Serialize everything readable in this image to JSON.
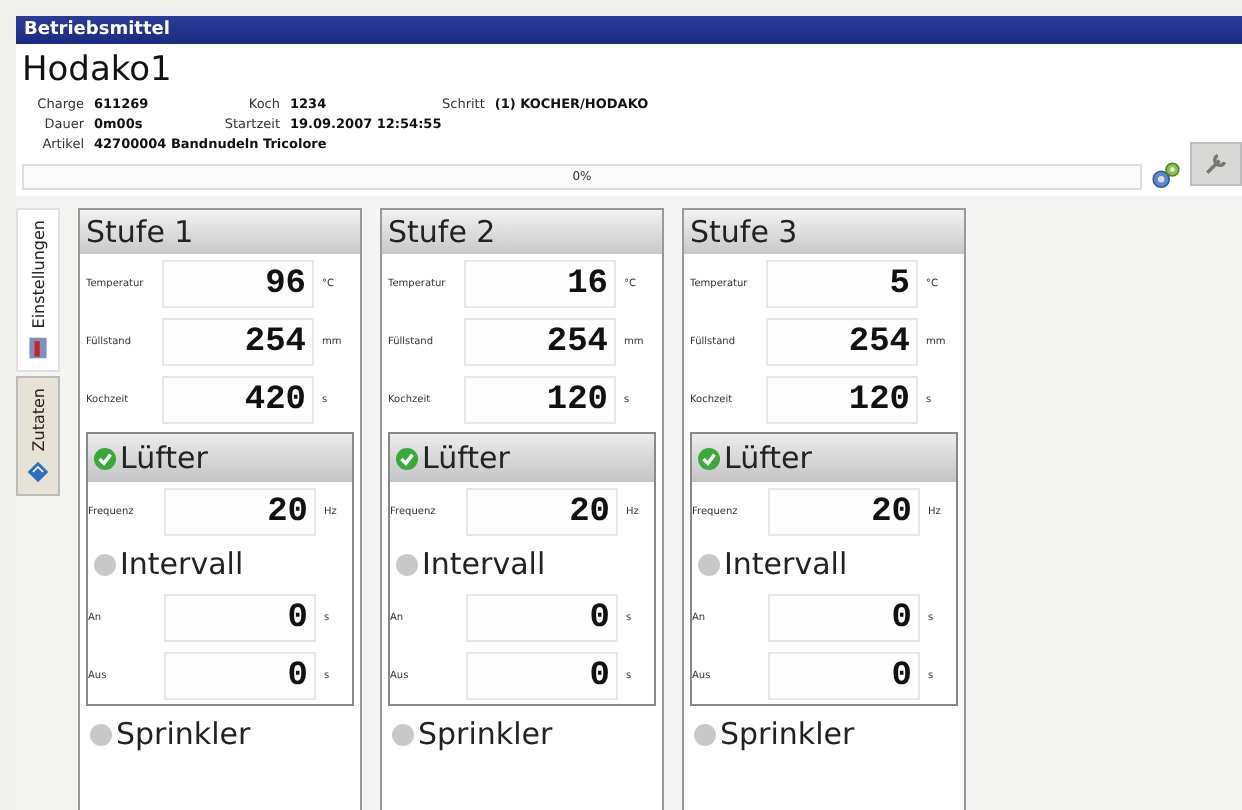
{
  "window": {
    "title": "Betriebsmittel"
  },
  "header": {
    "name": "Hodako1",
    "field_rows": [
      [
        {
          "label": "Charge",
          "value": "611269"
        },
        {
          "label": "Koch",
          "value": "1234"
        },
        {
          "label": "Schritt",
          "value": "(1) KOCHER/HODAKO"
        }
      ],
      [
        {
          "label": "Dauer",
          "value": "0m00s"
        },
        {
          "label": "Startzeit",
          "value": "19.09.2007 12:54:55"
        }
      ],
      [
        {
          "label": "Artikel",
          "value": "42700004 Bandnudeln Tricolore"
        }
      ]
    ],
    "progress": {
      "reading": "0%"
    }
  },
  "tabs": [
    {
      "label": "Einstellungen",
      "selected": true
    },
    {
      "label": "Zutaten",
      "selected": false
    }
  ],
  "stages": [
    {
      "title": "Stufe 1",
      "params": [
        {
          "label": "Temperatur",
          "value": "96",
          "unit": "°C"
        },
        {
          "label": "Füllstand",
          "value": "254",
          "unit": "mm"
        },
        {
          "label": "Kochzeit",
          "value": "420",
          "unit": "s"
        }
      ],
      "fan": {
        "label": "Lüfter",
        "on": true,
        "params": [
          {
            "label": "Frequenz",
            "value": "20",
            "unit": "Hz"
          }
        ],
        "interval": {
          "label": "Intervall",
          "on": false,
          "params": [
            {
              "label": "An",
              "value": "0",
              "unit": "s"
            },
            {
              "label": "Aus",
              "value": "0",
              "unit": "s"
            }
          ]
        }
      },
      "sprinkler": {
        "label": "Sprinkler",
        "on": false
      }
    },
    {
      "title": "Stufe 2",
      "params": [
        {
          "label": "Temperatur",
          "value": "16",
          "unit": "°C"
        },
        {
          "label": "Füllstand",
          "value": "254",
          "unit": "mm"
        },
        {
          "label": "Kochzeit",
          "value": "120",
          "unit": "s"
        }
      ],
      "fan": {
        "label": "Lüfter",
        "on": true,
        "params": [
          {
            "label": "Frequenz",
            "value": "20",
            "unit": "Hz"
          }
        ],
        "interval": {
          "label": "Intervall",
          "on": false,
          "params": [
            {
              "label": "An",
              "value": "0",
              "unit": "s"
            },
            {
              "label": "Aus",
              "value": "0",
              "unit": "s"
            }
          ]
        }
      },
      "sprinkler": {
        "label": "Sprinkler",
        "on": false
      }
    },
    {
      "title": "Stufe 3",
      "params": [
        {
          "label": "Temperatur",
          "value": "5",
          "unit": "°C"
        },
        {
          "label": "Füllstand",
          "value": "254",
          "unit": "mm"
        },
        {
          "label": "Kochzeit",
          "value": "120",
          "unit": "s"
        }
      ],
      "fan": {
        "label": "Lüfter",
        "on": true,
        "params": [
          {
            "label": "Frequenz",
            "value": "20",
            "unit": "Hz"
          }
        ],
        "interval": {
          "label": "Intervall",
          "on": false,
          "params": [
            {
              "label": "An",
              "value": "0",
              "unit": "s"
            },
            {
              "label": "Aus",
              "value": "0",
              "unit": "s"
            }
          ]
        }
      },
      "sprinkler": {
        "label": "Sprinkler",
        "on": false
      }
    }
  ]
}
